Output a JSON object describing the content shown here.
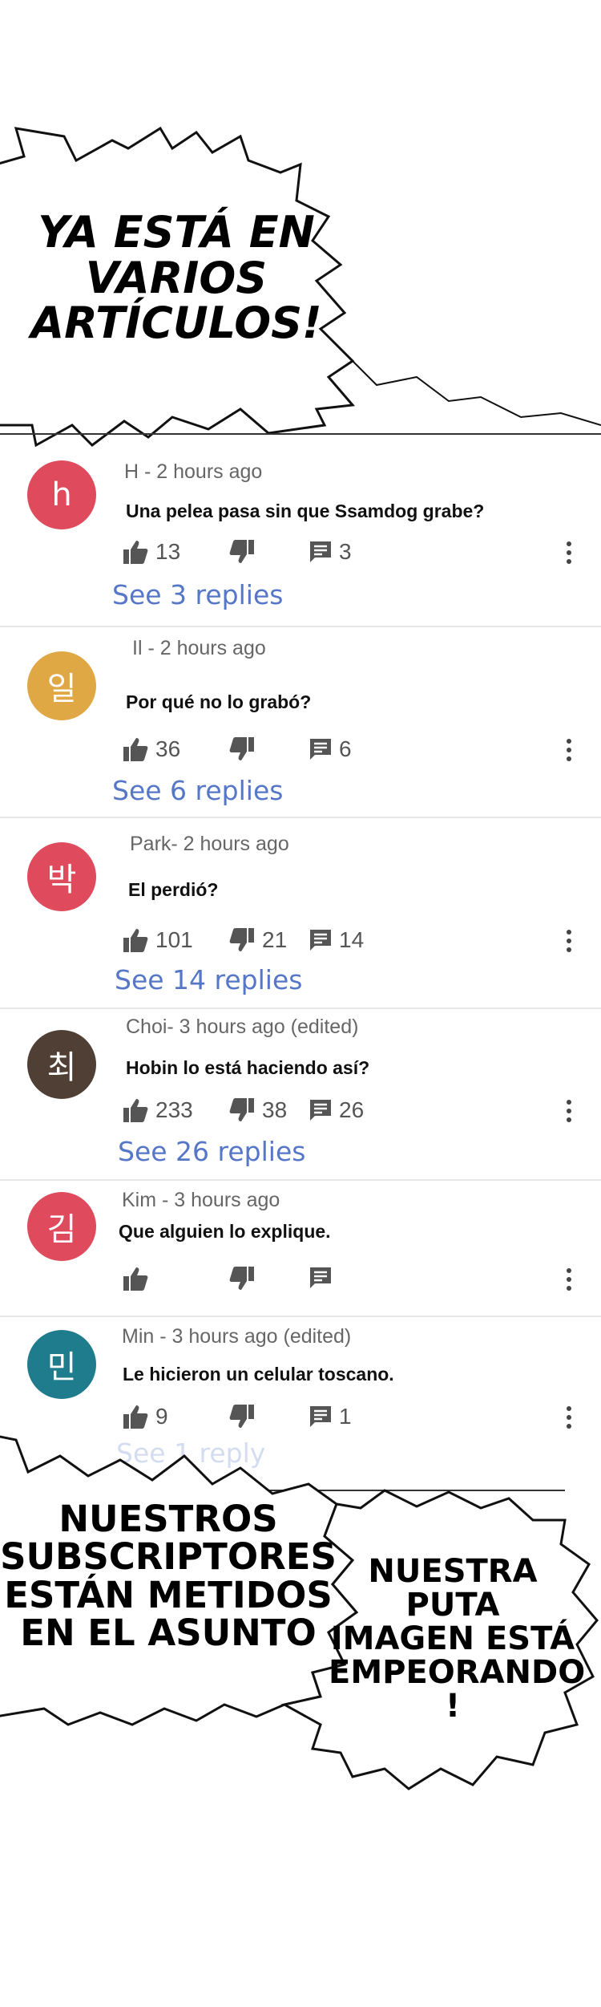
{
  "bubble_top": {
    "lines": [
      "YA ESTÁ EN",
      "VARIOS",
      "ARTÍCULOS!"
    ]
  },
  "bubble_bottom_left": {
    "lines": [
      "NUESTROS",
      "SUBSCRIPTORES",
      "ESTÁN METIDOS",
      "EN EL ASUNTO"
    ]
  },
  "bubble_bottom_right": {
    "lines": [
      "NUESTRA",
      "PUTA",
      "IMAGEN ESTÁ",
      "EMPEORANDO",
      "!"
    ]
  },
  "colors": {
    "avatar_h": "#df4a5c",
    "avatar_il": "#e0a845",
    "avatar_park": "#df4a5c",
    "avatar_choi": "#4f3f34",
    "avatar_kim": "#df4a5c",
    "avatar_min": "#1f7c8d",
    "link": "#5677c7"
  },
  "comments": [
    {
      "avatar": "h",
      "author": "H - 2 hours ago",
      "text": "Una pelea pasa sin que Ssamdog grabe?",
      "likes": "13",
      "dislikes": "",
      "replies_count": "3",
      "see_replies": "See 3 replies"
    },
    {
      "avatar": "일",
      "author": "Il - 2 hours ago",
      "text": "Por qué no lo grabó?",
      "likes": "36",
      "dislikes": "",
      "replies_count": "6",
      "see_replies": "See 6 replies"
    },
    {
      "avatar": "박",
      "author": "Park- 2 hours ago",
      "text": "El perdió?",
      "likes": "101",
      "dislikes": "21",
      "replies_count": "14",
      "see_replies": "See 14 replies"
    },
    {
      "avatar": "최",
      "author": "Choi- 3 hours ago (edited)",
      "text": "Hobin lo está haciendo así?",
      "likes": "233",
      "dislikes": "38",
      "replies_count": "26",
      "see_replies": "See 26 replies"
    },
    {
      "avatar": "김",
      "author": "Kim - 3 hours ago",
      "text": "Que alguien lo explique.",
      "likes": "",
      "dislikes": "",
      "replies_count": "",
      "see_replies": ""
    },
    {
      "avatar": "민",
      "author": "Min - 3 hours ago (edited)",
      "text": "Le hicieron un celular toscano.",
      "likes": "9",
      "dislikes": "",
      "replies_count": "1",
      "see_replies": "See 1 reply"
    }
  ]
}
